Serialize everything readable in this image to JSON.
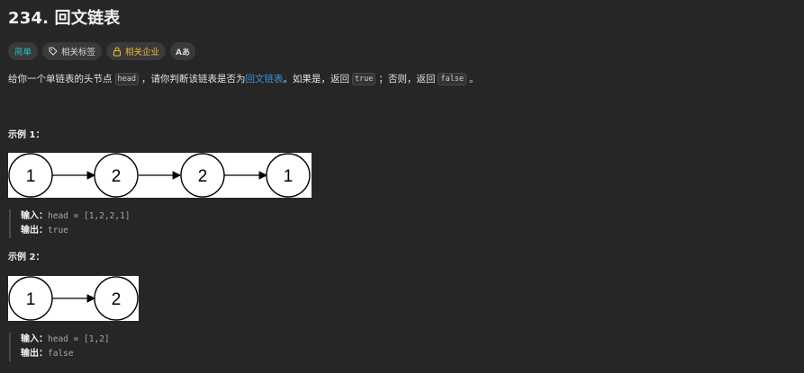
{
  "problem": {
    "title": "234. 回文链表",
    "tags": {
      "difficulty": "简单",
      "related_tags": "相关标签",
      "related_companies": "相关企业",
      "language_icon_label": "Aあ"
    },
    "description": {
      "part1": "给你一个单链表的头节点",
      "code_head": "head",
      "part2": "，请你判断该链表是否为",
      "link_text": "回文链表",
      "part3": "。如果是，返回",
      "code_true": "true",
      "part4": "；否则，返回",
      "code_false": "false",
      "part5": "。"
    }
  },
  "examples": [
    {
      "title": "示例 1：",
      "nodes": [
        "1",
        "2",
        "2",
        "1"
      ],
      "input_label": "输入：",
      "input_value": "head = [1,2,2,1]",
      "output_label": "输出：",
      "output_value": "true"
    },
    {
      "title": "示例 2：",
      "nodes": [
        "1",
        "2"
      ],
      "input_label": "输入：",
      "input_value": "head = [1,2]",
      "output_label": "输出：",
      "output_value": "false"
    }
  ],
  "colors": {
    "easy": "#1fc7b8",
    "company": "#f0b73a",
    "link": "#3e8fd6",
    "background": "#262626"
  }
}
